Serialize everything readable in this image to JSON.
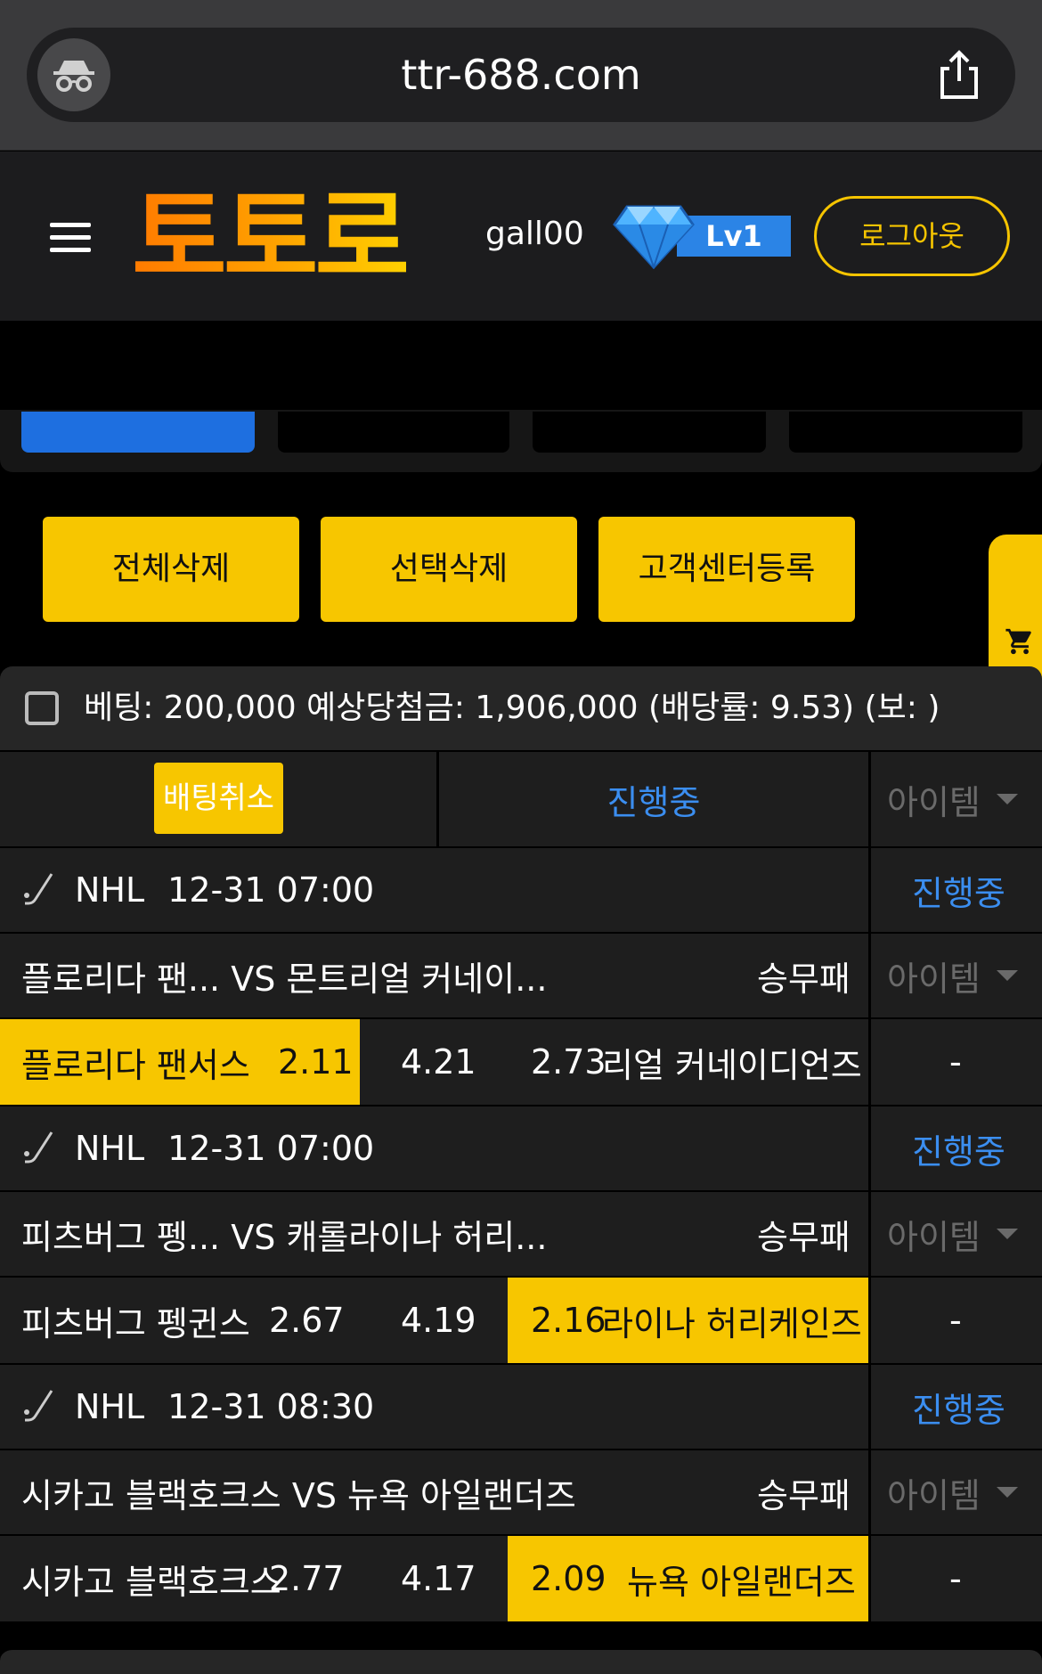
{
  "browser": {
    "url": "ttr-688.com",
    "incognito_icon": "incognito-icon",
    "share_icon": "share-icon"
  },
  "header": {
    "menu_icon": "hamburger-menu-icon",
    "logo_text": "토토로",
    "username": "gall00",
    "level_icon": "diamond-icon",
    "level_label": "Lv1",
    "logout_label": "로그아웃"
  },
  "actions": {
    "delete_all": "전체삭제",
    "delete_selected": "선택삭제",
    "register_support": "고객센터등록",
    "cart_icon": "cart-icon"
  },
  "summary": {
    "text": "베팅: 200,000 예상당첨금: 1,906,000 (배당률: 9.53) (보: )"
  },
  "table_header": {
    "cancel_label": "배팅취소",
    "status_label": "진행중",
    "item_label": "아이템"
  },
  "games": [
    {
      "league": "NHL",
      "datetime": "12-31 07:00",
      "status": "진행중",
      "matchup": "플로리다 팬...   VS 몬트리얼 커네이...",
      "market": "승무패",
      "item_label": "아이템",
      "home_name": "플로리다 팬서스",
      "home_odds": "2.11",
      "draw_odds": "4.21",
      "away_odds": "2.73",
      "away_name": "리얼 커네이디언즈",
      "selected": "home",
      "item_value": "-"
    },
    {
      "league": "NHL",
      "datetime": "12-31 07:00",
      "status": "진행중",
      "matchup": "피츠버그 펭...   VS 캐롤라이나 허리...",
      "market": "승무패",
      "item_label": "아이템",
      "home_name": "피츠버그 펭귄스",
      "home_odds": "2.67",
      "draw_odds": "4.19",
      "away_odds": "2.16",
      "away_name": "라이나 허리케인즈",
      "selected": "away",
      "item_value": "-"
    },
    {
      "league": "NHL",
      "datetime": "12-31 08:30",
      "status": "진행중",
      "matchup": "시카고 블랙호크스 VS 뉴욕 아일랜더즈",
      "market": "승무패",
      "item_label": "아이템",
      "home_name": "시카고 블랙호크스",
      "home_odds": "2.77",
      "draw_odds": "4.17",
      "away_odds": "2.09",
      "away_name": "뉴욕 아일랜더즈",
      "selected": "away",
      "item_value": "-"
    }
  ],
  "colors": {
    "accent_yellow": "#f7c600",
    "status_blue": "#3b8ef0",
    "active_tab_blue": "#1e6fe0"
  }
}
